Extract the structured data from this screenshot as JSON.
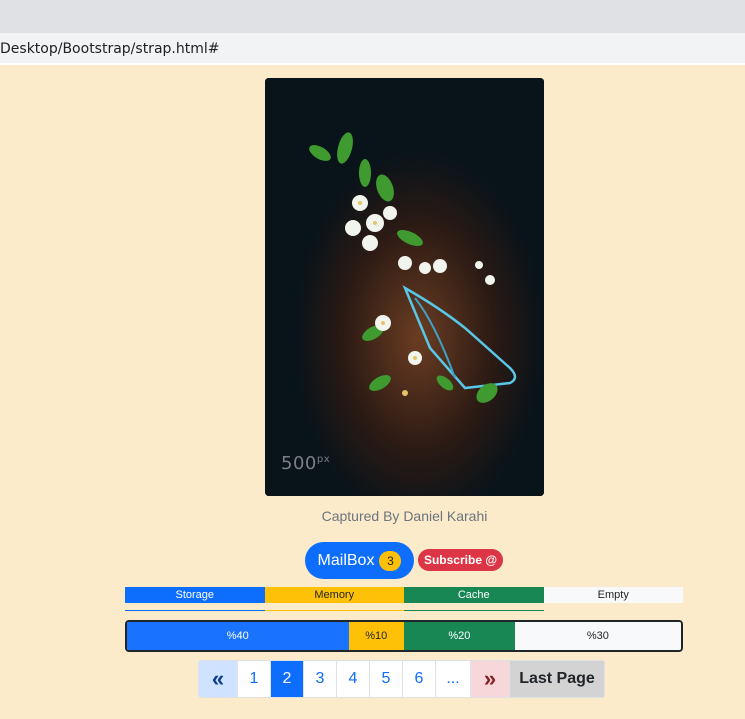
{
  "browser": {
    "address": "Desktop/Bootstrap/strap.html#"
  },
  "photo": {
    "watermark": "500",
    "watermark_sup": "px",
    "caption": "Captured By Daniel Karahi"
  },
  "badges": {
    "mailbox_label": "MailBox",
    "mailbox_count": "3",
    "subscribe_label": "Subscribe @",
    "colors": {
      "primary": "#0d6efd",
      "warning": "#ffc107",
      "danger": "#dc3545"
    }
  },
  "progress_labels": {
    "segments": [
      {
        "label": "Storage",
        "color": "#0d6efd"
      },
      {
        "label": "Memory",
        "color": "#ffc107"
      },
      {
        "label": "Cache",
        "color": "#198754"
      },
      {
        "label": "Empty",
        "color": "#f8f9fa"
      }
    ]
  },
  "progress_values": {
    "segments": [
      {
        "label": "%40",
        "value": 40,
        "color": "#1a73ff"
      },
      {
        "label": "%10",
        "value": 10,
        "color": "#ffc107"
      },
      {
        "label": "%20",
        "value": 20,
        "color": "#198754"
      },
      {
        "label": "%30",
        "value": 30,
        "color": "#f8f9fa"
      }
    ]
  },
  "pagination": {
    "first_icon": "«",
    "prev_icon": "»",
    "pages": [
      "1",
      "2",
      "3",
      "4",
      "5",
      "6",
      "..."
    ],
    "active_page": "2",
    "last_label": "Last Page"
  }
}
